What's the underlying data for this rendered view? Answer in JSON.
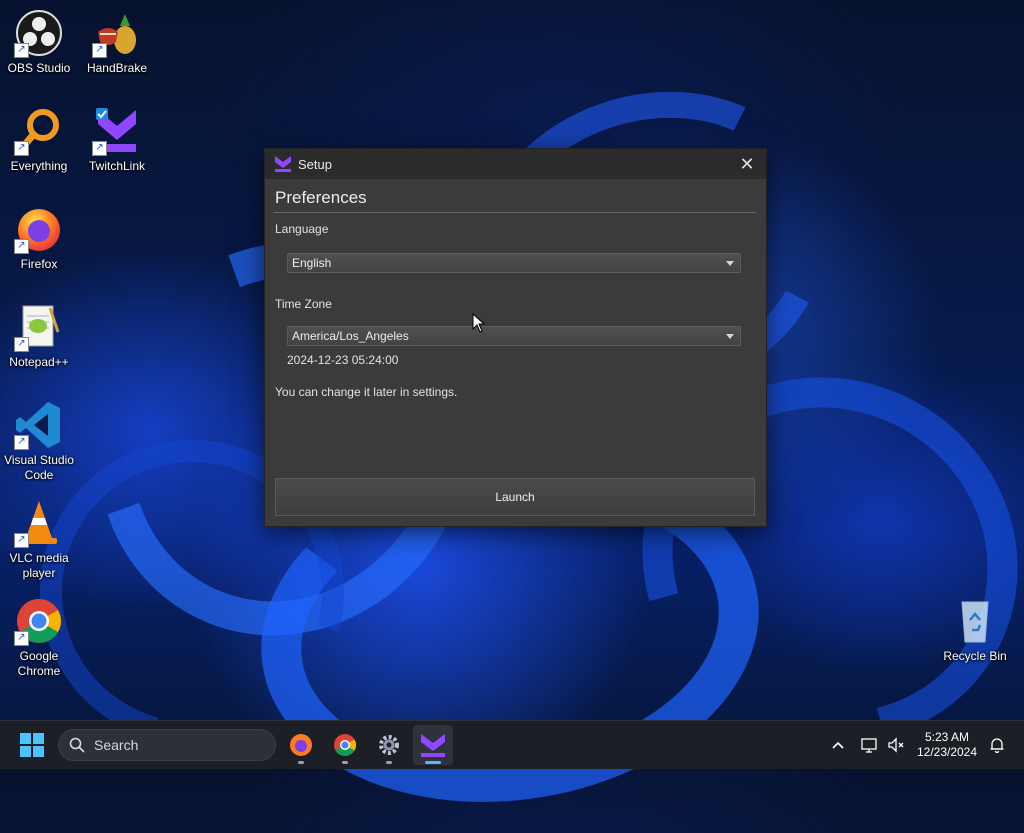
{
  "desktop": {
    "icons": [
      {
        "label": "OBS Studio"
      },
      {
        "label": "HandBrake"
      },
      {
        "label": "Everything"
      },
      {
        "label": "TwitchLink"
      },
      {
        "label": "Firefox"
      },
      {
        "label": "Notepad++"
      },
      {
        "label": "Visual Studio Code"
      },
      {
        "label": "VLC media player"
      },
      {
        "label": "Google Chrome"
      },
      {
        "label": "Recycle Bin"
      }
    ]
  },
  "dialog": {
    "title": "Setup",
    "close_glyph": "✕",
    "heading": "Preferences",
    "language_label": "Language",
    "language_value": "English",
    "timezone_label": "Time Zone",
    "timezone_value": "America/Los_Angeles",
    "datetime_preview": "2024-12-23 05:24:00",
    "note": "You can change it later in settings.",
    "launch_label": "Launch",
    "accent_color": "#9147ff"
  },
  "taskbar": {
    "search_label": "Search",
    "pinned": [
      "firefox-icon",
      "chrome-icon",
      "settings-gear-icon",
      "twitchlink-icon"
    ],
    "active_app": "twitchlink-icon",
    "clock_time": "5:23 AM",
    "clock_date": "12/23/2024"
  }
}
